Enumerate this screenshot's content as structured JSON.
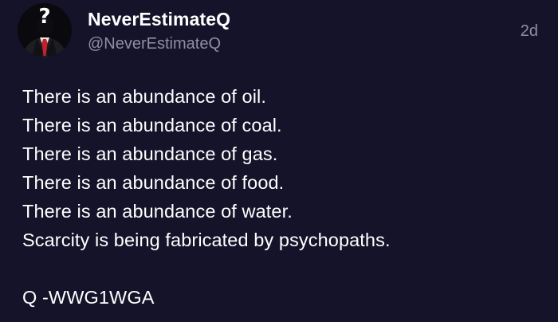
{
  "post": {
    "display_name": "NeverEstimateQ",
    "username": "@NeverEstimateQ",
    "timestamp": "2d",
    "lines": [
      "There is an abundance of oil.",
      "There is an abundance of coal.",
      "There is an abundance of gas.",
      "There is an abundance of food.",
      "There is an abundance of water.",
      "Scarcity is being fabricated by psychopaths."
    ],
    "signature": "Q -WWG1WGA"
  },
  "avatar": {
    "icon": "anonymous-suit-question-mark-avatar",
    "mark": "?"
  },
  "colors": {
    "background": "#14132a",
    "text": "#ffffff",
    "secondary": "#8f8fa3",
    "tie": "#c8202a"
  }
}
